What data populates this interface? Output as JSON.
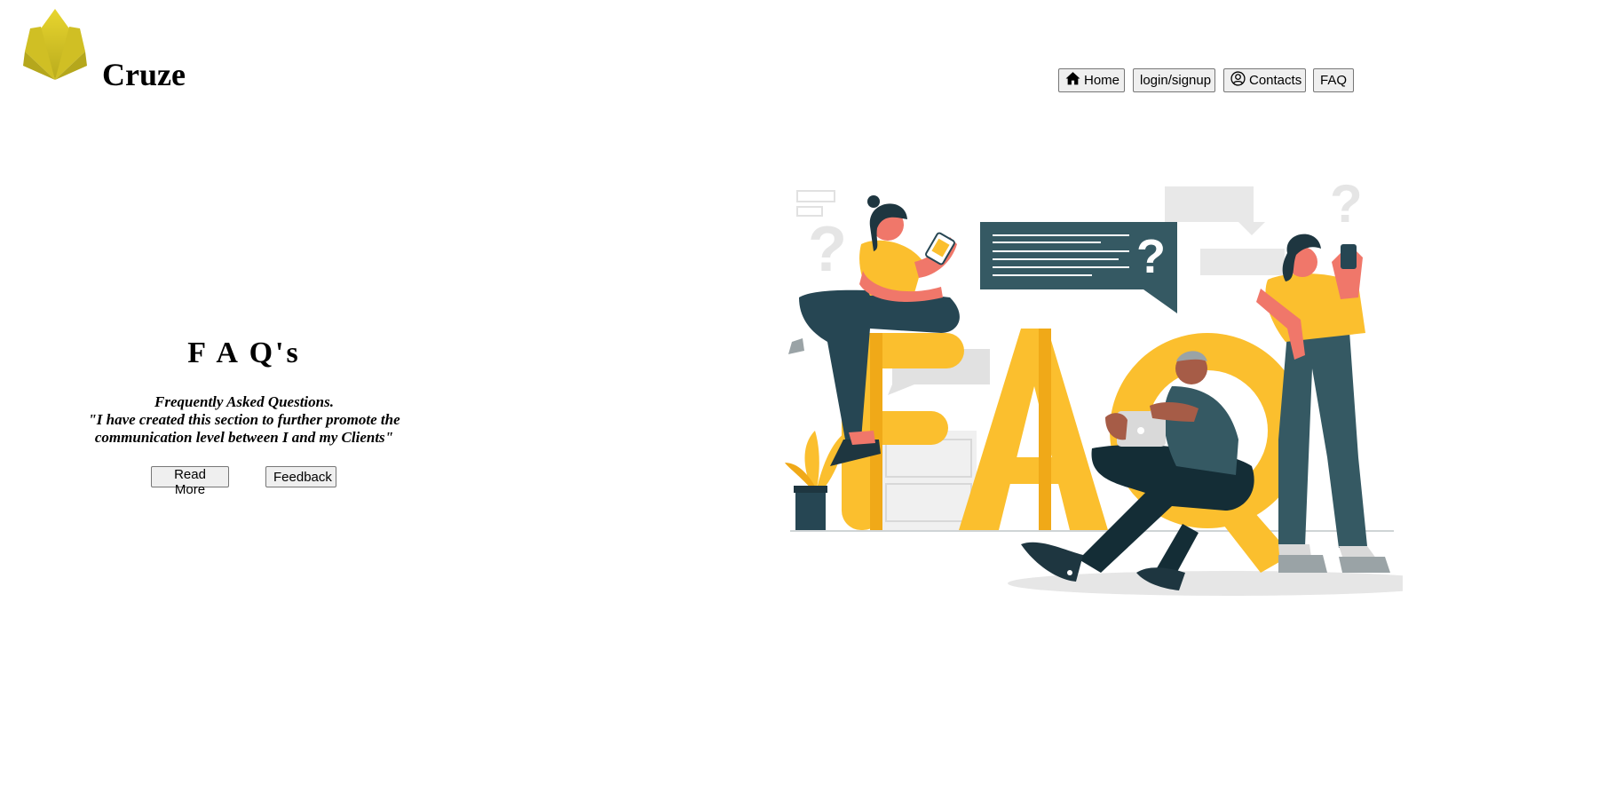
{
  "brand": {
    "name": "Cruze",
    "logo_icon": "crown-leaf-logo",
    "logo_color": "#d9c829"
  },
  "nav": {
    "home": {
      "label": "Home",
      "icon": "home-icon"
    },
    "login": {
      "label": "login/signup"
    },
    "contacts": {
      "label": "Contacts",
      "icon": "user-circle-icon"
    },
    "faq": {
      "label": "FAQ"
    }
  },
  "hero": {
    "title": "F A Q's",
    "line1": "Frequently Asked Questions.",
    "line2": "\"I have created this section to further promote the",
    "line3": "communication level between I and my Clients\"",
    "read_more": "Read More",
    "feedback": "Feedback"
  },
  "illustration": {
    "letters": "FAQ",
    "accent": "#fbbf2e",
    "dark": "#264653",
    "speech_bubble_icon": "question-mark-icon"
  }
}
